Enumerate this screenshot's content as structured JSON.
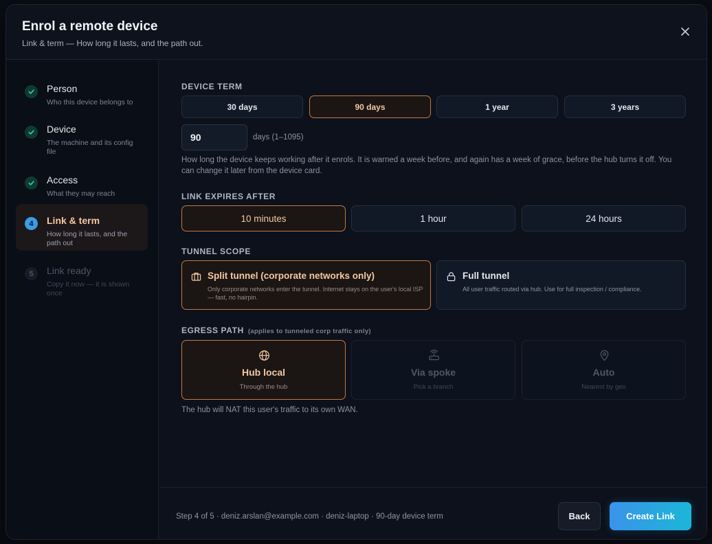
{
  "header": {
    "title": "Enrol a remote device",
    "subtitle": "Link & term — How long it lasts, and the path out."
  },
  "steps": [
    {
      "index": "1",
      "name": "Person",
      "desc": "Who this device belongs to",
      "state": "done"
    },
    {
      "index": "2",
      "name": "Device",
      "desc": "The machine and its config file",
      "state": "done"
    },
    {
      "index": "3",
      "name": "Access",
      "desc": "What they may reach",
      "state": "done"
    },
    {
      "index": "4",
      "name": "Link & term",
      "desc": "How long it lasts, and the path out",
      "state": "active"
    },
    {
      "index": "5",
      "name": "Link ready",
      "desc": "Copy it now — it is shown once",
      "state": "future"
    }
  ],
  "device_term": {
    "label": "DEVICE TERM",
    "options": [
      "30 days",
      "90 days",
      "1 year",
      "3 years"
    ],
    "selected": "90 days",
    "days_value": "90",
    "days_range": "days (1–1095)",
    "help": "How long the device keeps working after it enrols. It is warned a week before, and again has a week of grace, before the hub turns it off. You can change it later from the device card."
  },
  "link_expires": {
    "label": "LINK EXPIRES AFTER",
    "options": [
      "10 minutes",
      "1 hour",
      "24 hours"
    ],
    "selected": "10 minutes"
  },
  "tunnel_scope": {
    "label": "TUNNEL SCOPE",
    "options": [
      {
        "name": "Split tunnel (corporate networks only)",
        "desc": "Only corporate networks enter the tunnel. Internet stays on the user's local ISP — fast, no hairpin.",
        "icon": "briefcase-icon"
      },
      {
        "name": "Full tunnel",
        "desc": "All user traffic routed via hub. Use for full inspection / compliance.",
        "icon": "lock-icon"
      }
    ],
    "selected": "Split tunnel (corporate networks only)"
  },
  "egress": {
    "label": "EGRESS PATH",
    "label_sub": "(applies to tunneled corp traffic only)",
    "options": [
      {
        "name": "Hub local",
        "desc": "Through the hub",
        "icon": "globe-icon"
      },
      {
        "name": "Via spoke",
        "desc": "Pick a branch",
        "icon": "router-icon"
      },
      {
        "name": "Auto",
        "desc": "Nearest by geo",
        "icon": "map-pin-icon"
      }
    ],
    "selected": "Hub local",
    "note": "The hub will NAT this user's traffic to its own WAN."
  },
  "footer": {
    "summary": "Step 4 of 5 · deniz.arslan@example.com · deniz-laptop · 90-day device term",
    "back_label": "Back",
    "create_label": "Create Link"
  },
  "colors": {
    "accent_selected": "#c27a45",
    "primary_gradient_start": "#3a93ea",
    "primary_gradient_end": "#1cb6d8",
    "check_green": "#2fd39a"
  }
}
